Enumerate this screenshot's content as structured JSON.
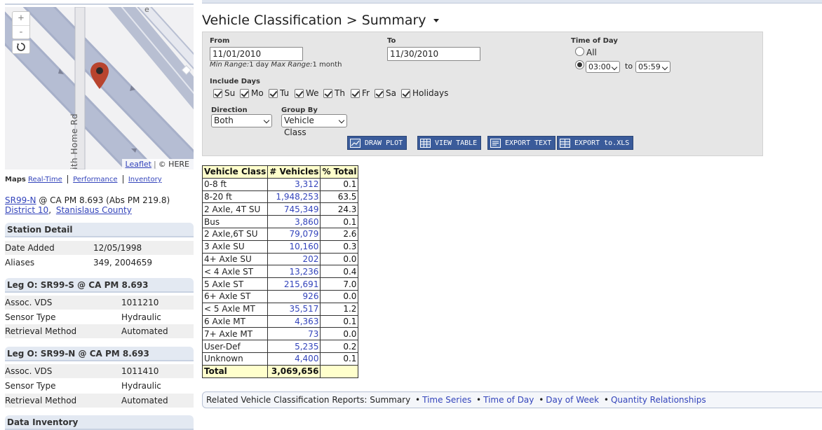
{
  "map": {
    "zoom_in": "+",
    "zoom_out": "-",
    "road_label": "ith Home Rd",
    "attribution_leaflet": "Leaflet",
    "attribution_sep": "|",
    "attribution_here": "© HERE",
    "edge_letter": "e"
  },
  "map_links": {
    "label": "Maps",
    "items": [
      "Real-Time",
      "Performance",
      "Inventory"
    ]
  },
  "station": {
    "route_link": "SR99-N",
    "location_text": "@ CA PM 8.693 (Abs PM 219.8)",
    "district": "District 10",
    "separator": ",",
    "county": "Stanislaus County"
  },
  "station_detail": {
    "title": "Station Detail",
    "rows": [
      {
        "label": "Date Added",
        "value": "12/05/1998"
      },
      {
        "label": "Aliases",
        "value": "349, 2004659"
      }
    ]
  },
  "legs": [
    {
      "title": "Leg O: SR99-S @ CA PM 8.693",
      "rows": [
        {
          "label": "Assoc. VDS",
          "value": "1011210"
        },
        {
          "label": "Sensor Type",
          "value": "Hydraulic"
        },
        {
          "label": "Retrieval Method",
          "value": "Automated"
        }
      ]
    },
    {
      "title": "Leg O: SR99-N @ CA PM 8.693",
      "rows": [
        {
          "label": "Assoc. VDS",
          "value": "1011410"
        },
        {
          "label": "Sensor Type",
          "value": "Hydraulic"
        },
        {
          "label": "Retrieval Method",
          "value": "Automated"
        }
      ]
    }
  ],
  "data_inventory": {
    "title": "Data Inventory"
  },
  "page": {
    "title": "Vehicle Classification > Summary"
  },
  "form": {
    "from_label": "From",
    "from_value": "11/01/2010",
    "to_label": "To",
    "to_value": "11/30/2010",
    "range_hint_min_label": "Min Range:",
    "range_hint_min_value": "1 day",
    "range_hint_max_label": "Max Range:",
    "range_hint_max_value": "1 month",
    "tod_label": "Time of Day",
    "tod_all": "All",
    "tod_start": "03:00",
    "tod_to": "to",
    "tod_end": "05:59",
    "include_days_label": "Include Days",
    "days": [
      "Su",
      "Mo",
      "Tu",
      "We",
      "Th",
      "Fr",
      "Sa",
      "Holidays"
    ],
    "direction_label": "Direction",
    "direction_value": "Both",
    "group_by_label": "Group By",
    "group_by_value": "Vehicle Class",
    "buttons": [
      "DRAW PLOT",
      "VIEW TABLE",
      "EXPORT TEXT",
      "EXPORT to.XLS"
    ]
  },
  "table": {
    "headers": [
      "Vehicle Class",
      "# Vehicles",
      "% Total"
    ],
    "rows": [
      [
        "0-8 ft",
        "3,312",
        "0.1"
      ],
      [
        "8-20 ft",
        "1,948,253",
        "63.5"
      ],
      [
        "2 Axle, 4T SU",
        "745,349",
        "24.3"
      ],
      [
        "Bus",
        "3,860",
        "0.1"
      ],
      [
        "2 Axle,6T SU",
        "79,079",
        "2.6"
      ],
      [
        "3 Axle SU",
        "10,160",
        "0.3"
      ],
      [
        "4+ Axle SU",
        "202",
        "0.0"
      ],
      [
        "< 4 Axle ST",
        "13,236",
        "0.4"
      ],
      [
        "5 Axle ST",
        "215,691",
        "7.0"
      ],
      [
        "6+ Axle ST",
        "926",
        "0.0"
      ],
      [
        "< 5 Axle MT",
        "35,517",
        "1.2"
      ],
      [
        "6 Axle MT",
        "4,363",
        "0.1"
      ],
      [
        "7+ Axle MT",
        "73",
        "0.0"
      ],
      [
        "User-Def",
        "5,235",
        "0.2"
      ],
      [
        "Unknown",
        "4,400",
        "0.1"
      ]
    ],
    "total": [
      "Total",
      "3,069,656",
      ""
    ]
  },
  "related": {
    "prefix": "Related Vehicle Classification Reports: Summary",
    "bullet": "•",
    "links": [
      "Time Series",
      "Time of Day",
      "Day of Week",
      "Quantity Relationships"
    ]
  },
  "colors": {
    "link": "#3344bb",
    "header_fill": "#ffffcc",
    "button": "#3a5b9a",
    "marker": "#b8442e"
  }
}
